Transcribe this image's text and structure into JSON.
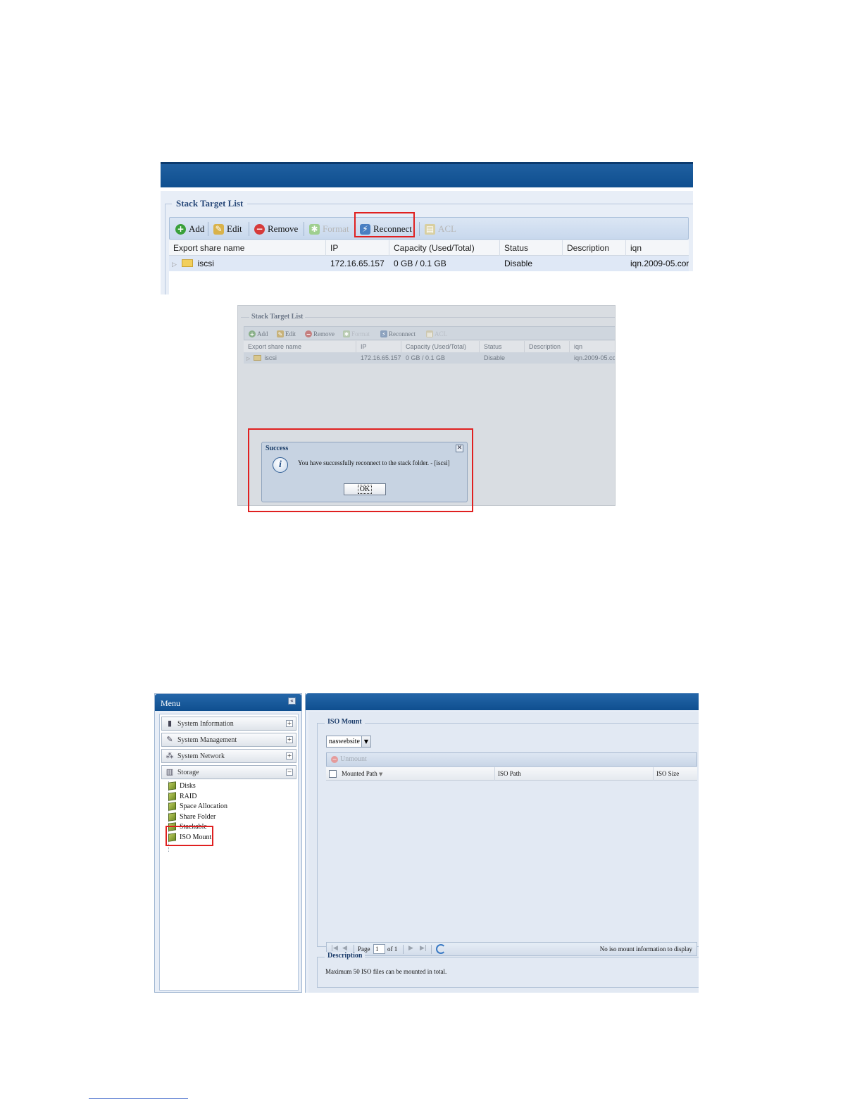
{
  "shot1": {
    "panel_title": "Stack Target List",
    "toolbar": {
      "add": "Add",
      "edit": "Edit",
      "remove": "Remove",
      "format": "Format",
      "reconnect": "Reconnect",
      "acl": "ACL"
    },
    "columns": [
      "Export share name",
      "IP",
      "Capacity (Used/Total)",
      "Status",
      "Description",
      "iqn"
    ],
    "row": {
      "name": "iscsi",
      "ip": "172.16.65.157",
      "capacity": "0 GB / 0.1 GB",
      "status": "Disable",
      "description": "",
      "iqn": "iqn.2009-05.cor"
    }
  },
  "shot2": {
    "panel_title": "Stack Target List",
    "toolbar": {
      "add": "Add",
      "edit": "Edit",
      "remove": "Remove",
      "format": "Format",
      "reconnect": "Reconnect",
      "acl": "ACL"
    },
    "columns": [
      "Export share name",
      "IP",
      "Capacity (Used/Total)",
      "Status",
      "Description",
      "iqn"
    ],
    "row": {
      "name": "iscsi",
      "ip": "172.16.65.157",
      "capacity": "0 GB / 0.1 GB",
      "status": "Disable",
      "description": "",
      "iqn": "iqn.2009-05.cor"
    },
    "dialog": {
      "title": "Success",
      "message": "You have successfully reconnect to the stack folder. - [iscsi]",
      "ok": "OK"
    }
  },
  "shot3": {
    "menu_title": "Menu",
    "sections": [
      {
        "label": "System Information",
        "icon": "info-icon",
        "state": "+"
      },
      {
        "label": "System Management",
        "icon": "wrench-icon",
        "state": "+"
      },
      {
        "label": "System Network",
        "icon": "network-icon",
        "state": "+"
      },
      {
        "label": "Storage",
        "icon": "storage-icon",
        "state": "−"
      }
    ],
    "storage_items": [
      "Disks",
      "RAID",
      "Space Allocation",
      "Share Folder",
      "Stackable",
      "ISO Mount"
    ],
    "iso_panel_title": "ISO Mount",
    "share_select": "naswebsite",
    "unmount": "Unmount",
    "columns": [
      "Mounted Path",
      "ISO Path",
      "ISO Size"
    ],
    "pager": {
      "page_label": "Page",
      "page_value": "1",
      "of_label": "of 1",
      "info": "No iso mount information to display"
    },
    "description_title": "Description",
    "description_text": "Maximum 50 ISO files can be mounted in total."
  }
}
